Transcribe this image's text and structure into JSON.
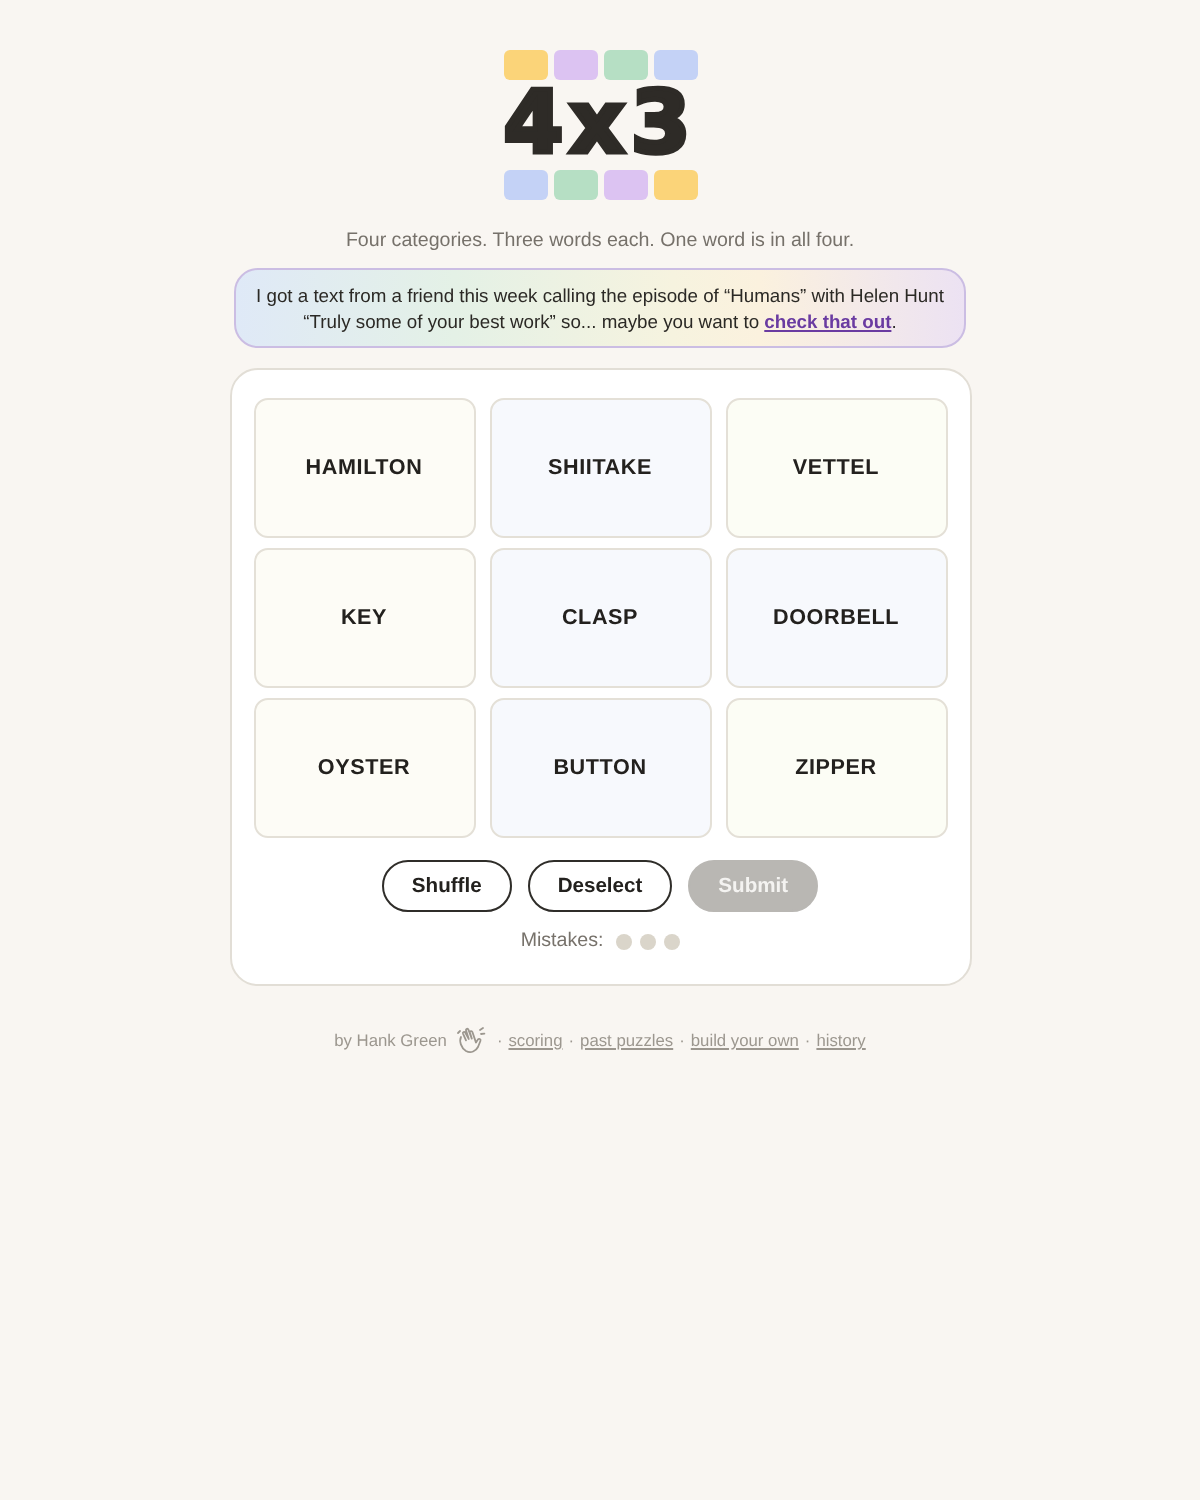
{
  "logo": {
    "top_squares": [
      {
        "color": "#fbd479"
      },
      {
        "color": "#dcc3f2"
      },
      {
        "color": "#b6dfc4"
      },
      {
        "color": "#c4d2f6"
      }
    ],
    "text": "4x3",
    "bottom_squares": [
      {
        "color": "#c4d2f6"
      },
      {
        "color": "#b6dfc4"
      },
      {
        "color": "#dcc3f2"
      },
      {
        "color": "#fbd479"
      }
    ]
  },
  "subtitle": "Four categories. Three words each. One word is in all four.",
  "announcement": {
    "text_before": "I got a text from a friend this week calling the episode of “Humans” with Helen Hunt “Truly some of your best work” so... maybe you want to ",
    "link": "check that out",
    "text_after": "."
  },
  "board": {
    "tiles": [
      {
        "word": "HAMILTON",
        "color": "#fdfcf6",
        "selected": false
      },
      {
        "word": "SHIITAKE",
        "color": "#f7f9fd",
        "selected": false
      },
      {
        "word": "VETTEL",
        "color": "#fcfdf5",
        "selected": false
      },
      {
        "word": "KEY",
        "color": "#fdfcf6",
        "selected": false
      },
      {
        "word": "CLASP",
        "color": "#f7f9fd",
        "selected": false
      },
      {
        "word": "DOORBELL",
        "color": "#f7f9fd",
        "selected": false
      },
      {
        "word": "OYSTER",
        "color": "#fdfcf6",
        "selected": false
      },
      {
        "word": "BUTTON",
        "color": "#f7f9fd",
        "selected": false
      },
      {
        "word": "ZIPPER",
        "color": "#fcfdf5",
        "selected": false
      }
    ],
    "buttons": [
      {
        "label": "Shuffle",
        "disabled": false
      },
      {
        "label": "Deselect",
        "disabled": false
      },
      {
        "label": "Submit",
        "disabled": true
      }
    ],
    "mistakes": {
      "label": "Mistakes:",
      "dots": [
        {
          "used": false
        },
        {
          "used": false
        },
        {
          "used": false
        }
      ]
    }
  },
  "footer": {
    "byline": "by Hank Green",
    "links": [
      {
        "separator": "·",
        "label": "scoring"
      },
      {
        "separator": "·",
        "label": "past puzzles"
      },
      {
        "separator": "·",
        "label": "build your own"
      },
      {
        "separator": "·",
        "label": "history"
      }
    ]
  }
}
